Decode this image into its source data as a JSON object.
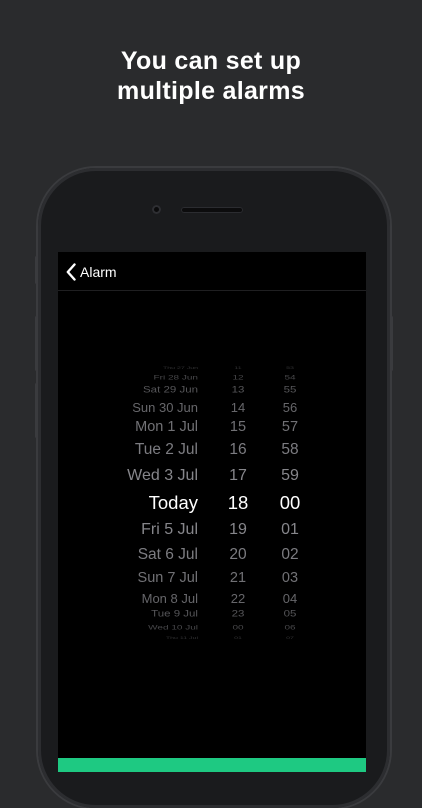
{
  "headline": {
    "line1": "You can set up",
    "line2": "multiple alarms"
  },
  "navbar": {
    "back_label": "Alarm",
    "back_icon": "chevron-left-icon"
  },
  "picker": {
    "dates": [
      "Thu 27 Jun",
      "Fri 28 Jun",
      "Sat 29 Jun",
      "Sun 30 Jun",
      "Mon 1 Jul",
      "Tue 2 Jul",
      "Wed 3 Jul",
      "Today",
      "Fri 5 Jul",
      "Sat 6 Jul",
      "Sun 7 Jul",
      "Mon 8 Jul",
      "Tue 9 Jul",
      "Wed 10 Jul",
      "Thu 11 Jul"
    ],
    "hours": [
      "11",
      "12",
      "13",
      "14",
      "15",
      "16",
      "17",
      "18",
      "19",
      "20",
      "21",
      "22",
      "23",
      "00",
      "01"
    ],
    "minutes": [
      "53",
      "54",
      "55",
      "56",
      "57",
      "58",
      "59",
      "00",
      "01",
      "02",
      "03",
      "04",
      "05",
      "06",
      "07"
    ],
    "selected_index": 7
  },
  "colors": {
    "accent": "#1ec982",
    "background": "#2a2b2d",
    "screen": "#000000"
  }
}
